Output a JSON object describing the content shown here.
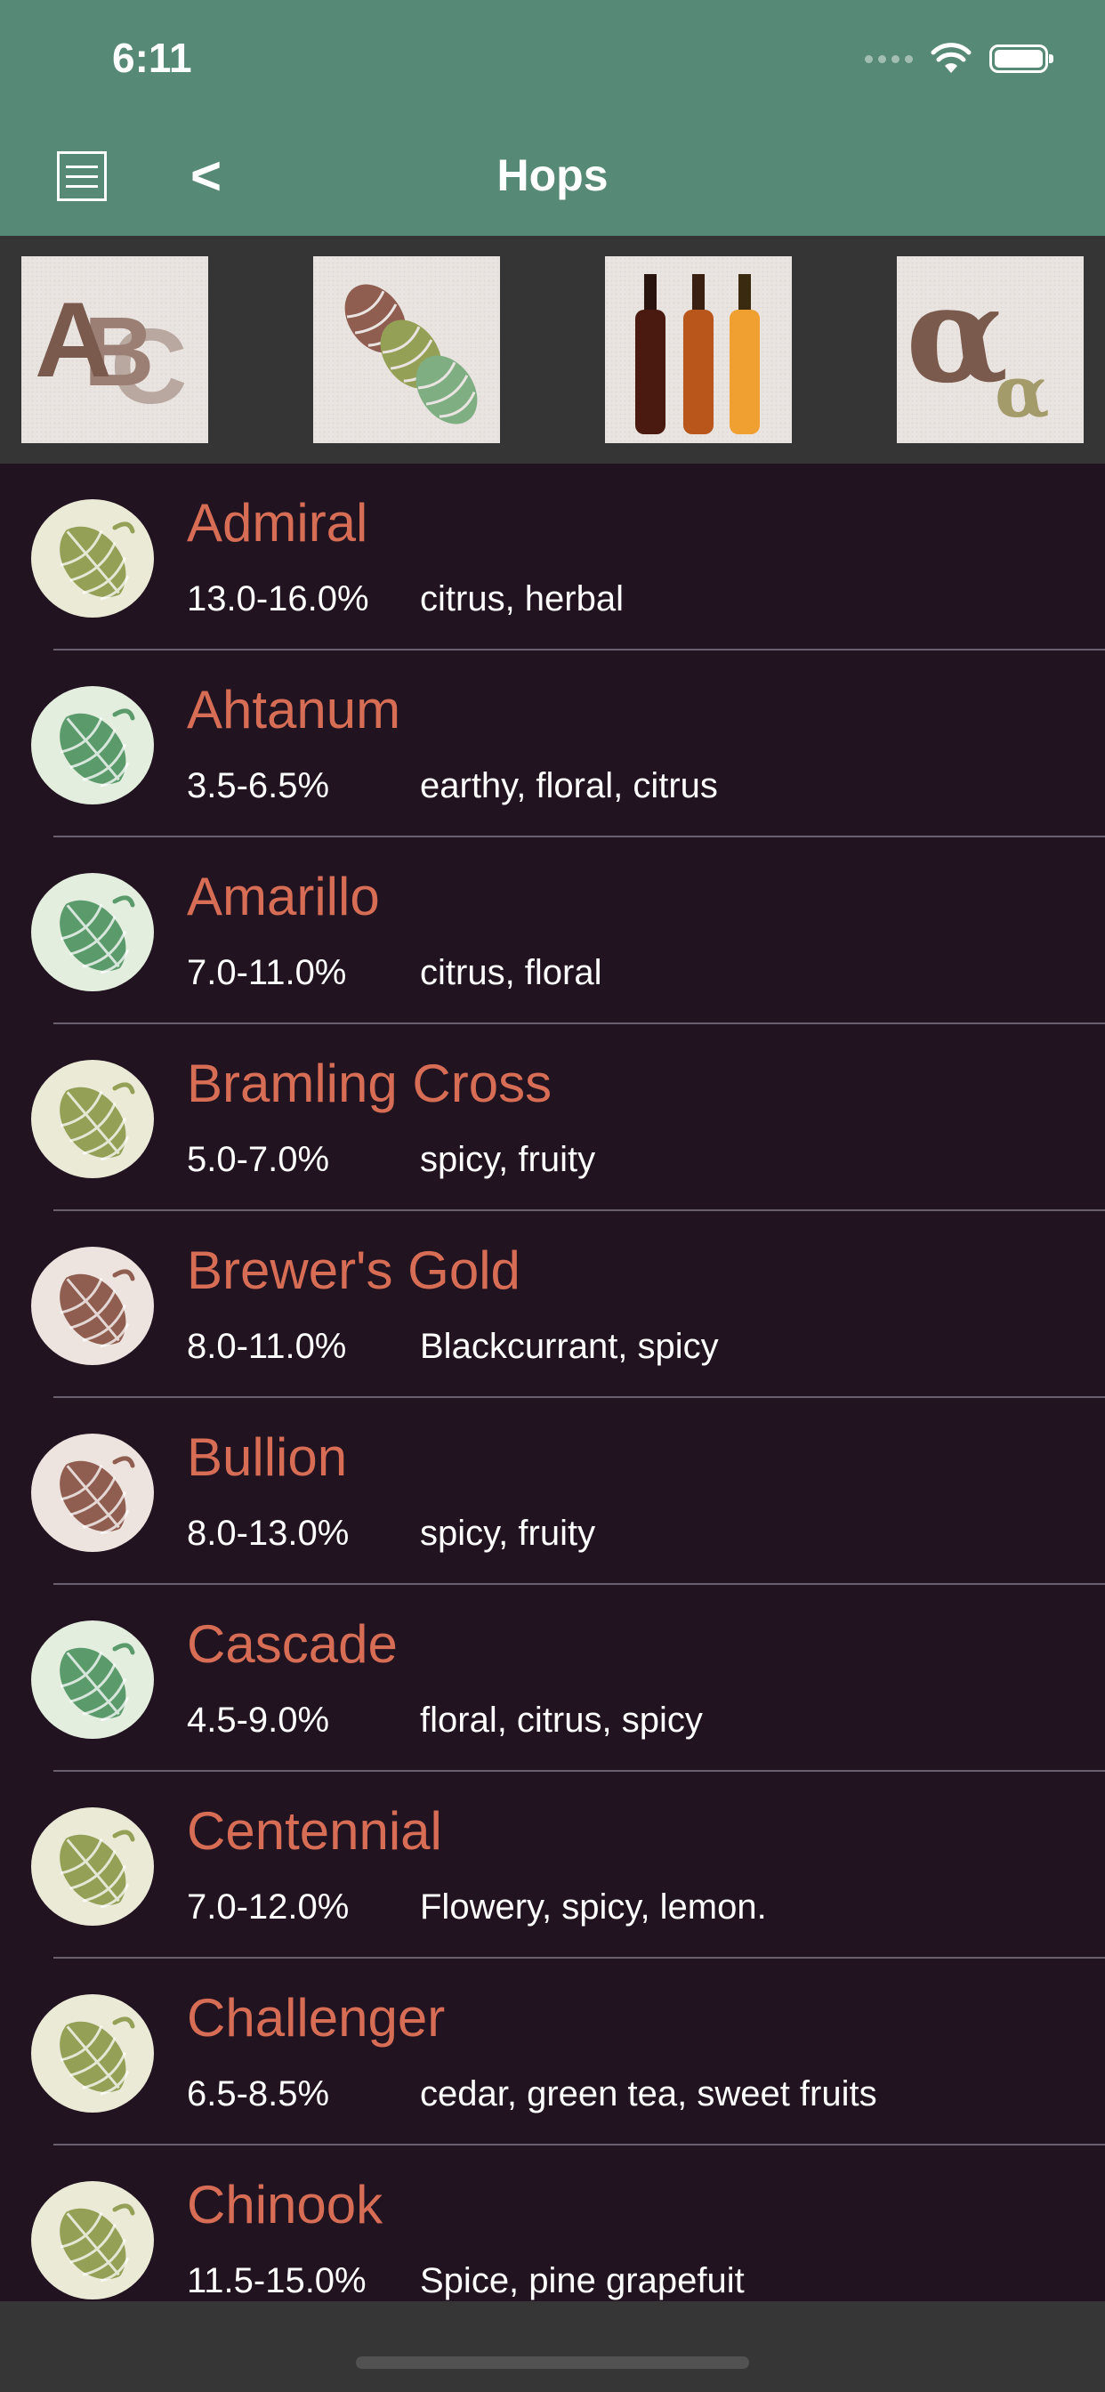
{
  "status": {
    "time": "6:11"
  },
  "nav": {
    "title": "Hops",
    "back": "<"
  },
  "sort_bar": {
    "tiles": [
      {
        "name": "sort-alphabetical",
        "icon": "abc-letters-icon"
      },
      {
        "name": "sort-by-hop-type",
        "icon": "hop-cones-icon"
      },
      {
        "name": "sort-by-beer-style",
        "icon": "beer-bottles-icon"
      },
      {
        "name": "sort-by-alpha-acid",
        "icon": "alpha-symbol-icon"
      }
    ]
  },
  "colors": {
    "header": "#578977",
    "background": "#211320",
    "name": "#d76d55",
    "hop_green": "#5b9a6b",
    "hop_olive": "#93a056",
    "hop_brown": "#8f5e50"
  },
  "hops": [
    {
      "name": "Admiral",
      "alpha": "13.0-16.0%",
      "aroma": "citrus, herbal",
      "icon_color": "olive"
    },
    {
      "name": "Ahtanum",
      "alpha": "3.5-6.5%",
      "aroma": "earthy, floral, citrus",
      "icon_color": "green"
    },
    {
      "name": "Amarillo",
      "alpha": "7.0-11.0%",
      "aroma": "citrus, floral",
      "icon_color": "green"
    },
    {
      "name": "Bramling Cross",
      "alpha": "5.0-7.0%",
      "aroma": "spicy, fruity",
      "icon_color": "olive"
    },
    {
      "name": "Brewer's Gold",
      "alpha": "8.0-11.0%",
      "aroma": "Blackcurrant, spicy",
      "icon_color": "brown"
    },
    {
      "name": "Bullion",
      "alpha": "8.0-13.0%",
      "aroma": "spicy, fruity",
      "icon_color": "brown"
    },
    {
      "name": "Cascade",
      "alpha": "4.5-9.0%",
      "aroma": "floral, citrus, spicy",
      "icon_color": "green"
    },
    {
      "name": "Centennial",
      "alpha": "7.0-12.0%",
      "aroma": "Flowery, spicy, lemon.",
      "icon_color": "olive"
    },
    {
      "name": "Challenger",
      "alpha": "6.5-8.5%",
      "aroma": "cedar, green tea, sweet fruits",
      "icon_color": "olive"
    },
    {
      "name": "Chinook",
      "alpha": "11.5-15.0%",
      "aroma": "Spice, pine grapefuit",
      "icon_color": "olive"
    }
  ]
}
